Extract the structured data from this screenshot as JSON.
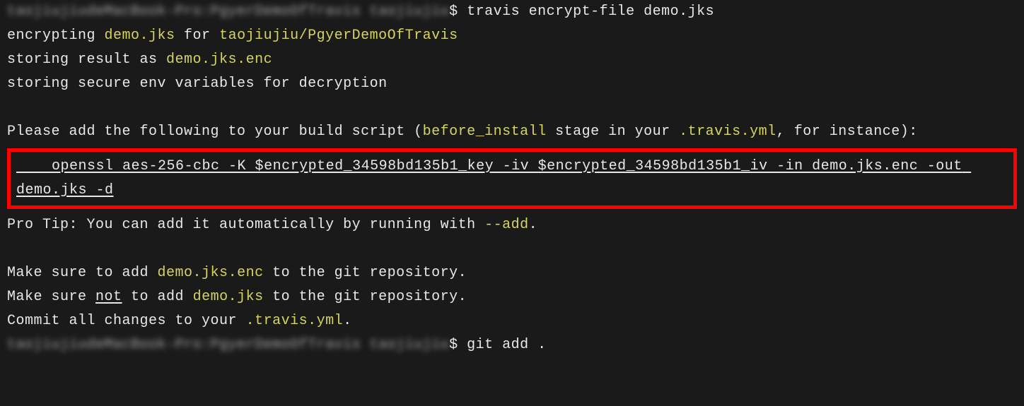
{
  "lines": {
    "prompt1_blurred": "taojiujiudeMacBook-Pro:PgyerDemoOfTravis taojiujiu",
    "prompt1_dollar": "$ ",
    "cmd1": "travis encrypt-file demo.jks",
    "l2_a": "encrypting ",
    "l2_b": "demo.jks",
    "l2_c": " for ",
    "l2_d": "taojiujiu/PgyerDemoOfTravis",
    "l3_a": "storing result as ",
    "l3_b": "demo.jks.enc",
    "l4": "storing secure env variables for decryption",
    "l6_a": "Please add the following to your build script (",
    "l6_b": "before_install",
    "l6_c": " stage in your ",
    "l6_d": ".travis.yml",
    "l6_e": ", for instance):",
    "box_line": "    openssl aes-256-cbc -K $encrypted_34598bd135b1_key -iv $encrypted_34598bd135b1_iv -in demo.jks.enc -out demo.jks -d",
    "l10_a": "Pro Tip: You can add it automatically by running with ",
    "l10_b": "--add",
    "l10_c": ".",
    "l12_a": "Make sure to add ",
    "l12_b": "demo.jks.enc",
    "l12_c": " to the git repository.",
    "l13_a": "Make sure ",
    "l13_b": "not",
    "l13_c": " to add ",
    "l13_d": "demo.jks",
    "l13_e": " to the git repository.",
    "l14_a": "Commit all changes to your ",
    "l14_b": ".travis.yml",
    "l14_c": ".",
    "prompt2_blurred": "taojiujiudeMacBook-Pro:PgyerDemoOfTravis taojiujiu",
    "prompt2_dollar": "$ ",
    "cmd2": "git add ."
  }
}
